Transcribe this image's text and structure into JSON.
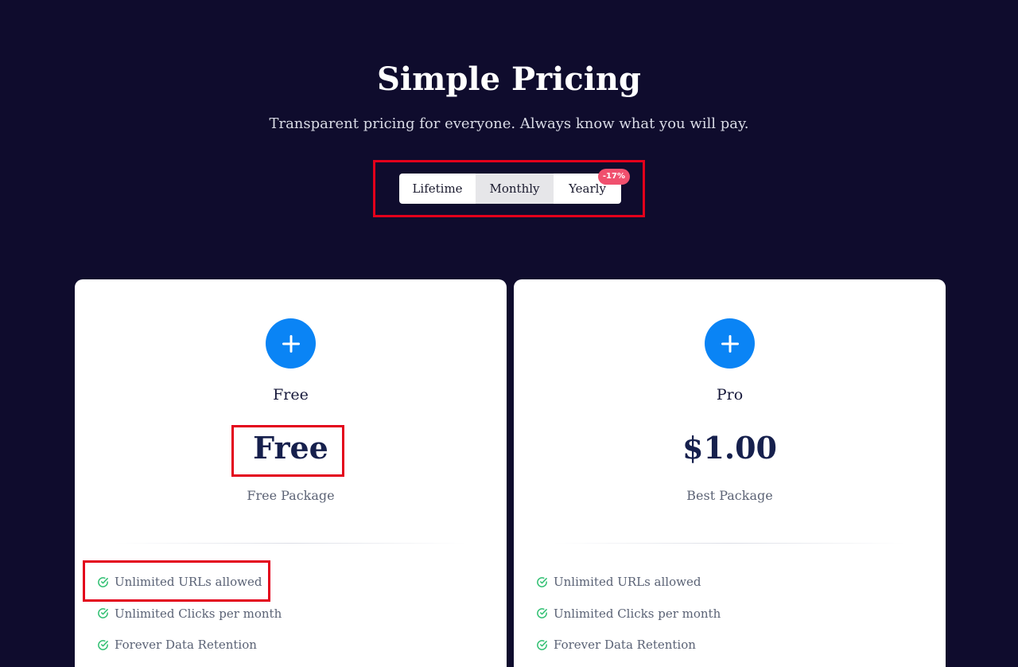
{
  "header": {
    "title": "Simple Pricing",
    "subtitle": "Transparent pricing for everyone. Always know what you will pay."
  },
  "billing_toggle": {
    "options": [
      {
        "label": "Lifetime",
        "selected": false
      },
      {
        "label": "Monthly",
        "selected": true
      },
      {
        "label": "Yearly",
        "selected": false,
        "badge": "-17%"
      }
    ]
  },
  "plans": [
    {
      "name": "Free",
      "price": "Free",
      "description": "Free Package",
      "icon": "plus-icon",
      "features": [
        "Unlimited URLs allowed",
        "Unlimited Clicks per month",
        "Forever Data Retention"
      ]
    },
    {
      "name": "Pro",
      "price": "$1.00",
      "description": "Best Package",
      "icon": "plus-icon",
      "features": [
        "Unlimited URLs allowed",
        "Unlimited Clicks per month",
        "Forever Data Retention"
      ]
    }
  ],
  "colors": {
    "background": "#0f0c2d",
    "accent": "#0a84f5",
    "check": "#2fbf71",
    "badge": "#f0506e",
    "highlight": "#e3001b"
  }
}
